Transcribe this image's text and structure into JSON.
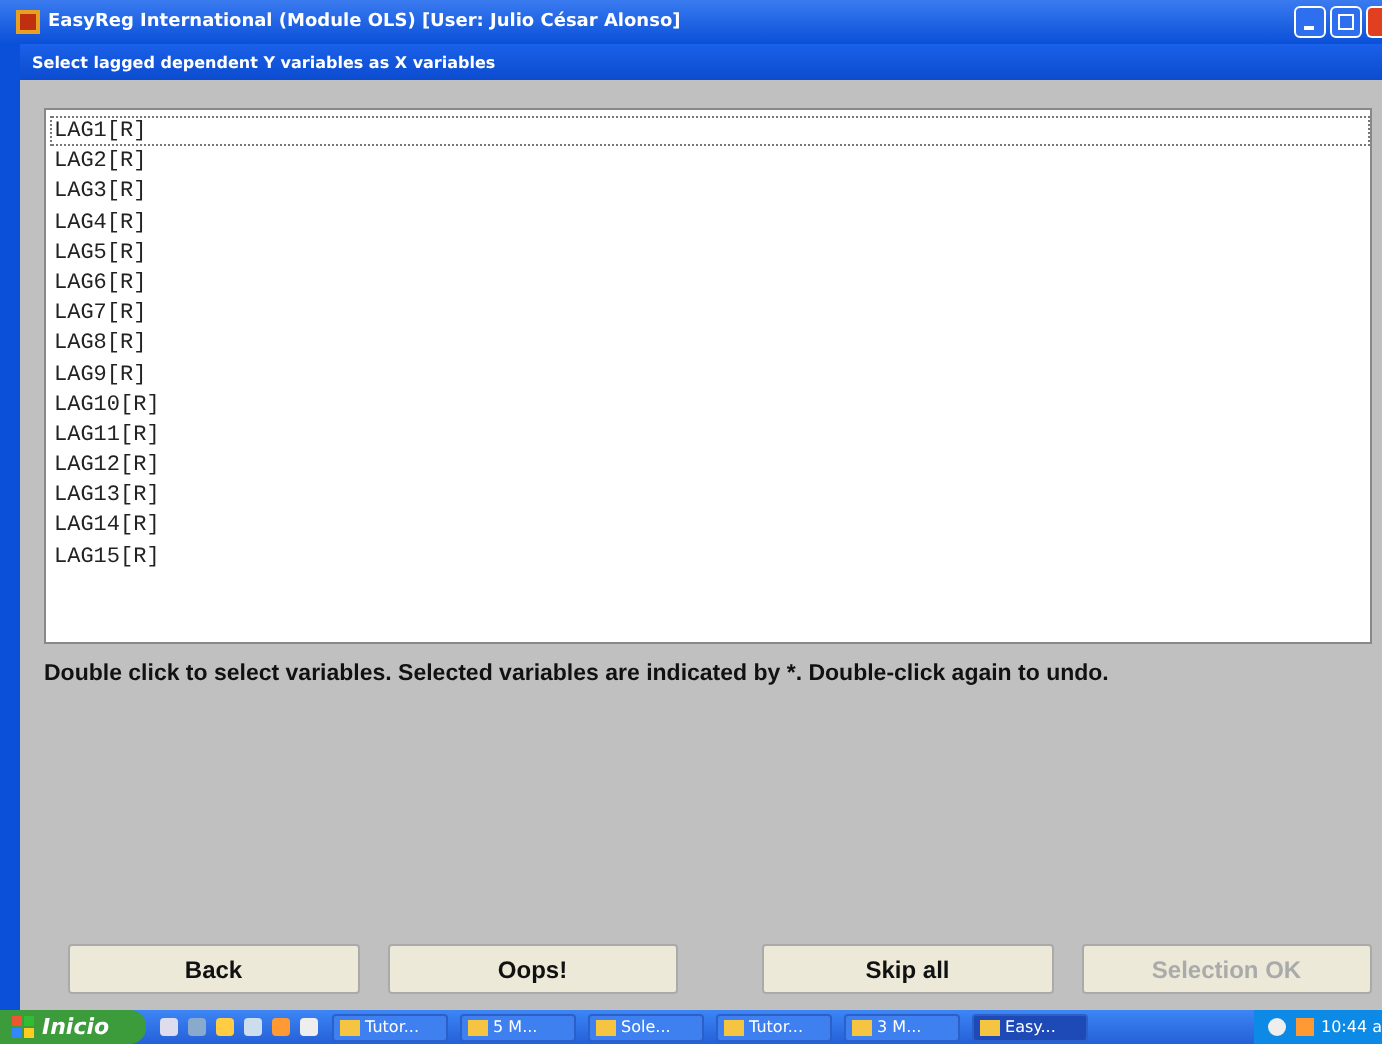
{
  "window": {
    "title": "EasyReg International (Module OLS) [User: Julio César Alonso]"
  },
  "subtitle": "Select lagged dependent Y variables as X variables",
  "list": {
    "items": [
      {
        "label": "LAG1[R]",
        "focused": true
      },
      {
        "label": "LAG2[R]",
        "focused": false
      },
      {
        "label": "LAG3[R]",
        "focused": false
      },
      {
        "label": "LAG4[R]",
        "focused": false
      },
      {
        "label": "LAG5[R]",
        "focused": false
      },
      {
        "label": "LAG6[R]",
        "focused": false
      },
      {
        "label": "LAG7[R]",
        "focused": false
      },
      {
        "label": "LAG8[R]",
        "focused": false
      },
      {
        "label": "LAG9[R]",
        "focused": false
      },
      {
        "label": "LAG10[R]",
        "focused": false
      },
      {
        "label": "LAG11[R]",
        "focused": false
      },
      {
        "label": "LAG12[R]",
        "focused": false
      },
      {
        "label": "LAG13[R]",
        "focused": false
      },
      {
        "label": "LAG14[R]",
        "focused": false
      },
      {
        "label": "LAG15[R]",
        "focused": false
      }
    ]
  },
  "instructions": "Double click to select variables. Selected variables are indicated by *. Double-click again to undo.",
  "buttons": [
    {
      "label": "Back",
      "disabled": false
    },
    {
      "label": "Oops!",
      "disabled": false
    },
    {
      "label": "Skip all",
      "disabled": false
    },
    {
      "label": "Selection OK",
      "disabled": true
    }
  ],
  "taskbar": {
    "start": "Inicio",
    "tasks": [
      {
        "label": "Tutor...",
        "selected": false
      },
      {
        "label": "5 M...",
        "selected": false
      },
      {
        "label": "Sole...",
        "selected": false
      },
      {
        "label": "Tutor...",
        "selected": false
      },
      {
        "label": "3 M...",
        "selected": false
      },
      {
        "label": "Easy...",
        "selected": true
      }
    ],
    "clock": "10:44 a"
  }
}
